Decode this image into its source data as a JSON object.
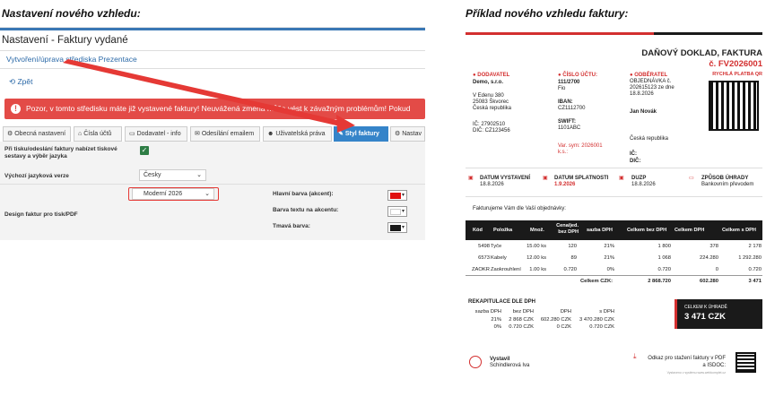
{
  "left_caption": "Nastavení nového vzhledu:",
  "right_caption": "Příklad nového vzhledu faktury:",
  "window": {
    "title": "Nastavení - Faktury vydané",
    "sublink": "Vytvoření/úprava střediska Prezentace",
    "back": "Zpět",
    "alert": "Pozor, v tomto středisku máte již vystavené faktury! Neuvážená změna může vést k závažným problémům! Pokud"
  },
  "tabs": [
    {
      "label": "Obecná nastavení",
      "icon": "gear-icon"
    },
    {
      "label": "Čísla účtů",
      "icon": "bank-icon"
    },
    {
      "label": "Dodavatel - info",
      "icon": "card-icon"
    },
    {
      "label": "Odesílání emailem",
      "icon": "mail-icon"
    },
    {
      "label": "Uživatelská práva",
      "icon": "users-icon"
    },
    {
      "label": "Styl faktury",
      "icon": "brush-icon"
    },
    {
      "label": "Nastav",
      "icon": "gear-icon"
    }
  ],
  "form": {
    "send_label": "Při tisku/odeslání faktury nabízet tiskové sestavy a výběr jazyka",
    "lang_label": "Výchozí jazyková verze",
    "lang_value": "Česky",
    "design_label": "Design faktur pro tisk/PDF",
    "design_value": "Moderní 2026",
    "main_color_label": "Hlavní barva (akcent):",
    "text_color_label": "Barva textu na akcentu:",
    "dark_color_label": "Tmavá barva:",
    "main_color": "#e01010",
    "text_color": "#ffffff",
    "dark_color": "#1a1a1a"
  },
  "invoice": {
    "title": "DAŇOVÝ DOKLAD, FAKTURA",
    "number": "č. FV2026001",
    "payment": "RYCHLÁ PLATBA QR",
    "supplier_h": "DODAVATEL",
    "supplier": [
      "Demo, s.r.o.",
      "",
      "V Edenu 380",
      "25083 Škvorec",
      "Česká republika",
      "",
      "IČ: 27902510",
      "DIČ: CZ123456"
    ],
    "account_h": "ČÍSLO ÚČTU:",
    "account": "111/2700",
    "bank": "Fio",
    "iban_h": "IBAN:",
    "iban": "CZ1112700",
    "swift_h": "SWIFT:",
    "swift": "1101ABC",
    "vs": "Var. sym: 2026001",
    "ks": "k.s.:",
    "customer_h": "ODBĚRATEL",
    "customer": [
      "OBJEDNÁVKA č.",
      "202615123 ze dne",
      "18.8.2026",
      "",
      "Jan Novák",
      "",
      "",
      "Česká republika",
      "",
      "IČ:",
      "DIČ:"
    ],
    "dates": [
      {
        "h": "DATUM VYSTAVENÍ",
        "v": "18.8.2026"
      },
      {
        "h": "DATUM SPLATNOSTI",
        "v": "1.9.2026"
      },
      {
        "h": "DUZP",
        "v": "18.8.2026"
      },
      {
        "h": "ZPŮSOB ÚHRADY",
        "v": "Bankovním převodem"
      }
    ],
    "intro": "Fakturujeme Vám dle Vaší objednávky:",
    "columns": [
      "Kód",
      "Položka",
      "Množ.",
      "Cena/jed. bez DPH",
      "sazba DPH",
      "Celkem bez DPH",
      "Celkem DPH",
      "Celkem s DPH"
    ],
    "rows": [
      [
        "5498",
        "Tyče",
        "15.00 ks",
        "120",
        "21%",
        "1 800",
        "378",
        "2 178"
      ],
      [
        "6573",
        "Kabely",
        "12.00 ks",
        "89",
        "21%",
        "1 068",
        "224.280",
        "1 292.280"
      ],
      [
        "ZAOKR",
        "Zaokrouhlení",
        "1.00 ks",
        "0.720",
        "0%",
        "0.720",
        "0",
        "0.720"
      ]
    ],
    "sum_label": "Celkem CZK:",
    "sums": [
      "2 868.720",
      "602.280",
      "3 471"
    ],
    "recap_h": "REKAPITULACE DLE DPH",
    "recap_cols": [
      "sazba DPH",
      "bez DPH",
      "DPH",
      "s DPH"
    ],
    "recap_rows": [
      [
        "21%",
        "2 868 CZK",
        "602.280 CZK",
        "3 470.280 CZK"
      ],
      [
        "0%",
        "0.720 CZK",
        "0 CZK",
        "0.720 CZK"
      ]
    ],
    "due_label": "CELKEM K ÚHRADĚ",
    "due": "3 471 CZK",
    "issuer_h": "Vystavil",
    "issuer": "Schindlerová Iva",
    "download": "Odkaz pro stažení faktury v PDF a ISDOC:",
    "footer": "Vystaveno v systému www.webkomplet.cz"
  }
}
